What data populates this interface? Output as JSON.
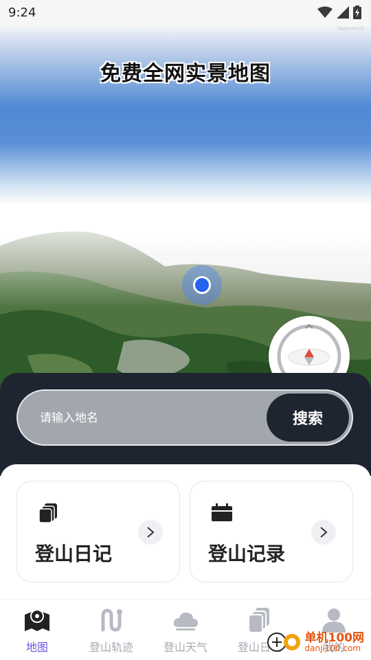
{
  "status_bar": {
    "time": "9:24",
    "icons": [
      "wifi-icon",
      "signal-icon",
      "battery-charging-icon"
    ]
  },
  "map": {
    "title": "免费全网实景地图",
    "watermark": "WaterMark",
    "controls": [
      "location-dot-icon",
      "compass-icon"
    ]
  },
  "search": {
    "placeholder": "请输入地名",
    "value": "",
    "button_label": "搜索"
  },
  "cards": [
    {
      "label": "登山日记",
      "icon": "diary-stack-icon",
      "arrow": "chevron-right-icon"
    },
    {
      "label": "登山记录",
      "icon": "record-calendar-icon",
      "arrow": "chevron-right-icon"
    }
  ],
  "tabs": [
    {
      "label": "地图",
      "icon": "map-icon",
      "active": true
    },
    {
      "label": "登山轨迹",
      "icon": "track-icon",
      "active": false
    },
    {
      "label": "登山天气",
      "icon": "cloud-icon",
      "active": false
    },
    {
      "label": "登山日记",
      "icon": "diary-icon",
      "active": false
    },
    {
      "label": "我的",
      "icon": "user-icon",
      "active": false
    }
  ],
  "brand_watermark": {
    "name": "单机100网",
    "domain": "danji100.com"
  },
  "colors": {
    "accent": "#6a57e0",
    "panel_dark": "#1f2530",
    "location_blue": "#2563eb",
    "brand_orange": "#e2550e"
  }
}
